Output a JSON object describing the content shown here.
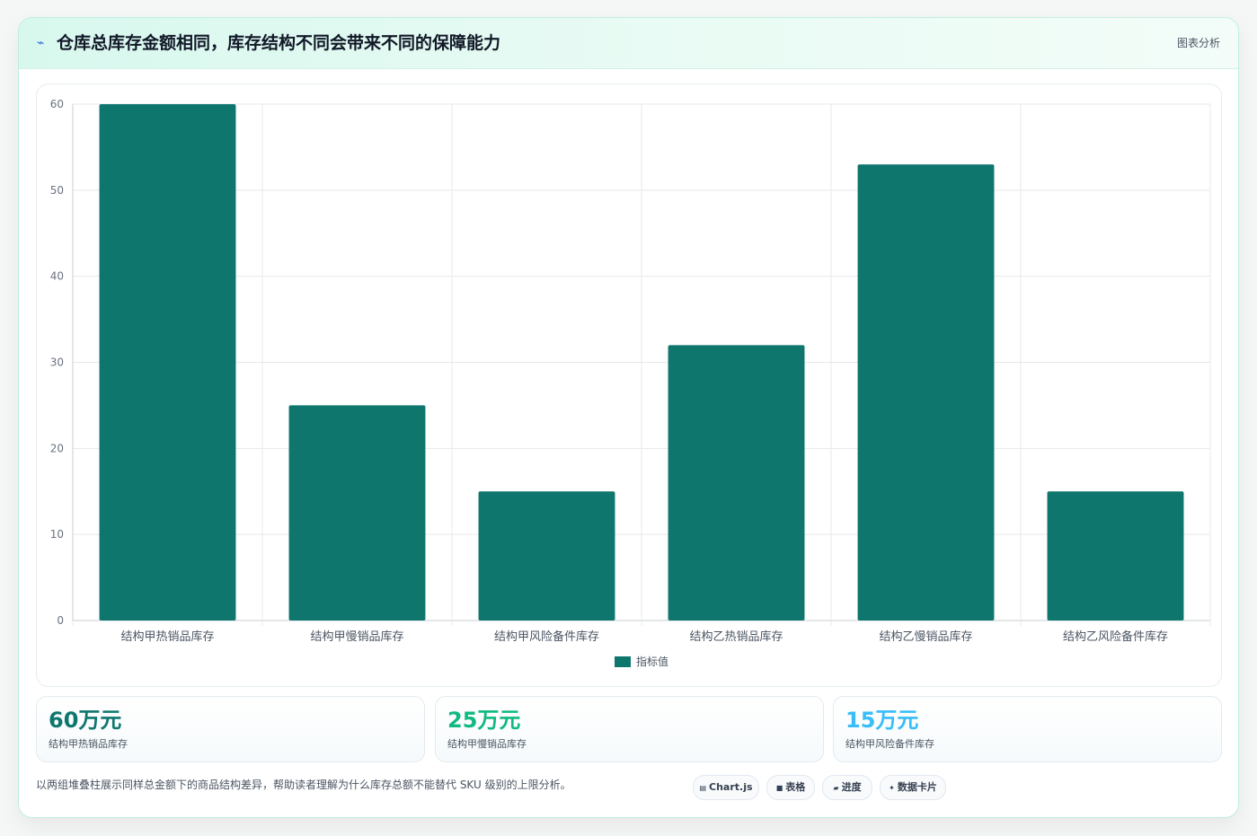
{
  "header": {
    "icon": "lightning-icon",
    "title": "仓库总库存金额相同，库存结构不同会带来不同的保障能力",
    "tag": "图表分析"
  },
  "chart_data": {
    "type": "bar",
    "categories": [
      "结构甲热销品库存",
      "结构甲慢销品库存",
      "结构甲风险备件库存",
      "结构乙热销品库存",
      "结构乙慢销品库存",
      "结构乙风险备件库存"
    ],
    "series": [
      {
        "name": "指标值",
        "values": [
          60,
          25,
          15,
          32,
          53,
          15
        ],
        "color": "#0f766e"
      }
    ],
    "ylim": [
      0,
      60
    ],
    "yticks": [
      0,
      10,
      20,
      30,
      40,
      50,
      60
    ],
    "grid": true,
    "legend": "bottom"
  },
  "stats": [
    {
      "value": "60万元",
      "label": "结构甲热销品库存",
      "color": "#0f766e"
    },
    {
      "value": "25万元",
      "label": "结构甲慢销品库存",
      "color": "#10b981"
    },
    {
      "value": "15万元",
      "label": "结构甲风险备件库存",
      "color": "#38bdf8"
    }
  ],
  "note": "以两组堆叠柱展示同样总金额下的商品结构差异，帮助读者理解为什么库存总额不能替代 SKU 级别的上限分析。",
  "tags": [
    {
      "icon": "chart-icon",
      "label": "Chart.js"
    },
    {
      "icon": "table-icon",
      "label": "表格"
    },
    {
      "icon": "progress-icon",
      "label": "进度"
    },
    {
      "icon": "sparkle-icon",
      "label": "数据卡片"
    }
  ]
}
